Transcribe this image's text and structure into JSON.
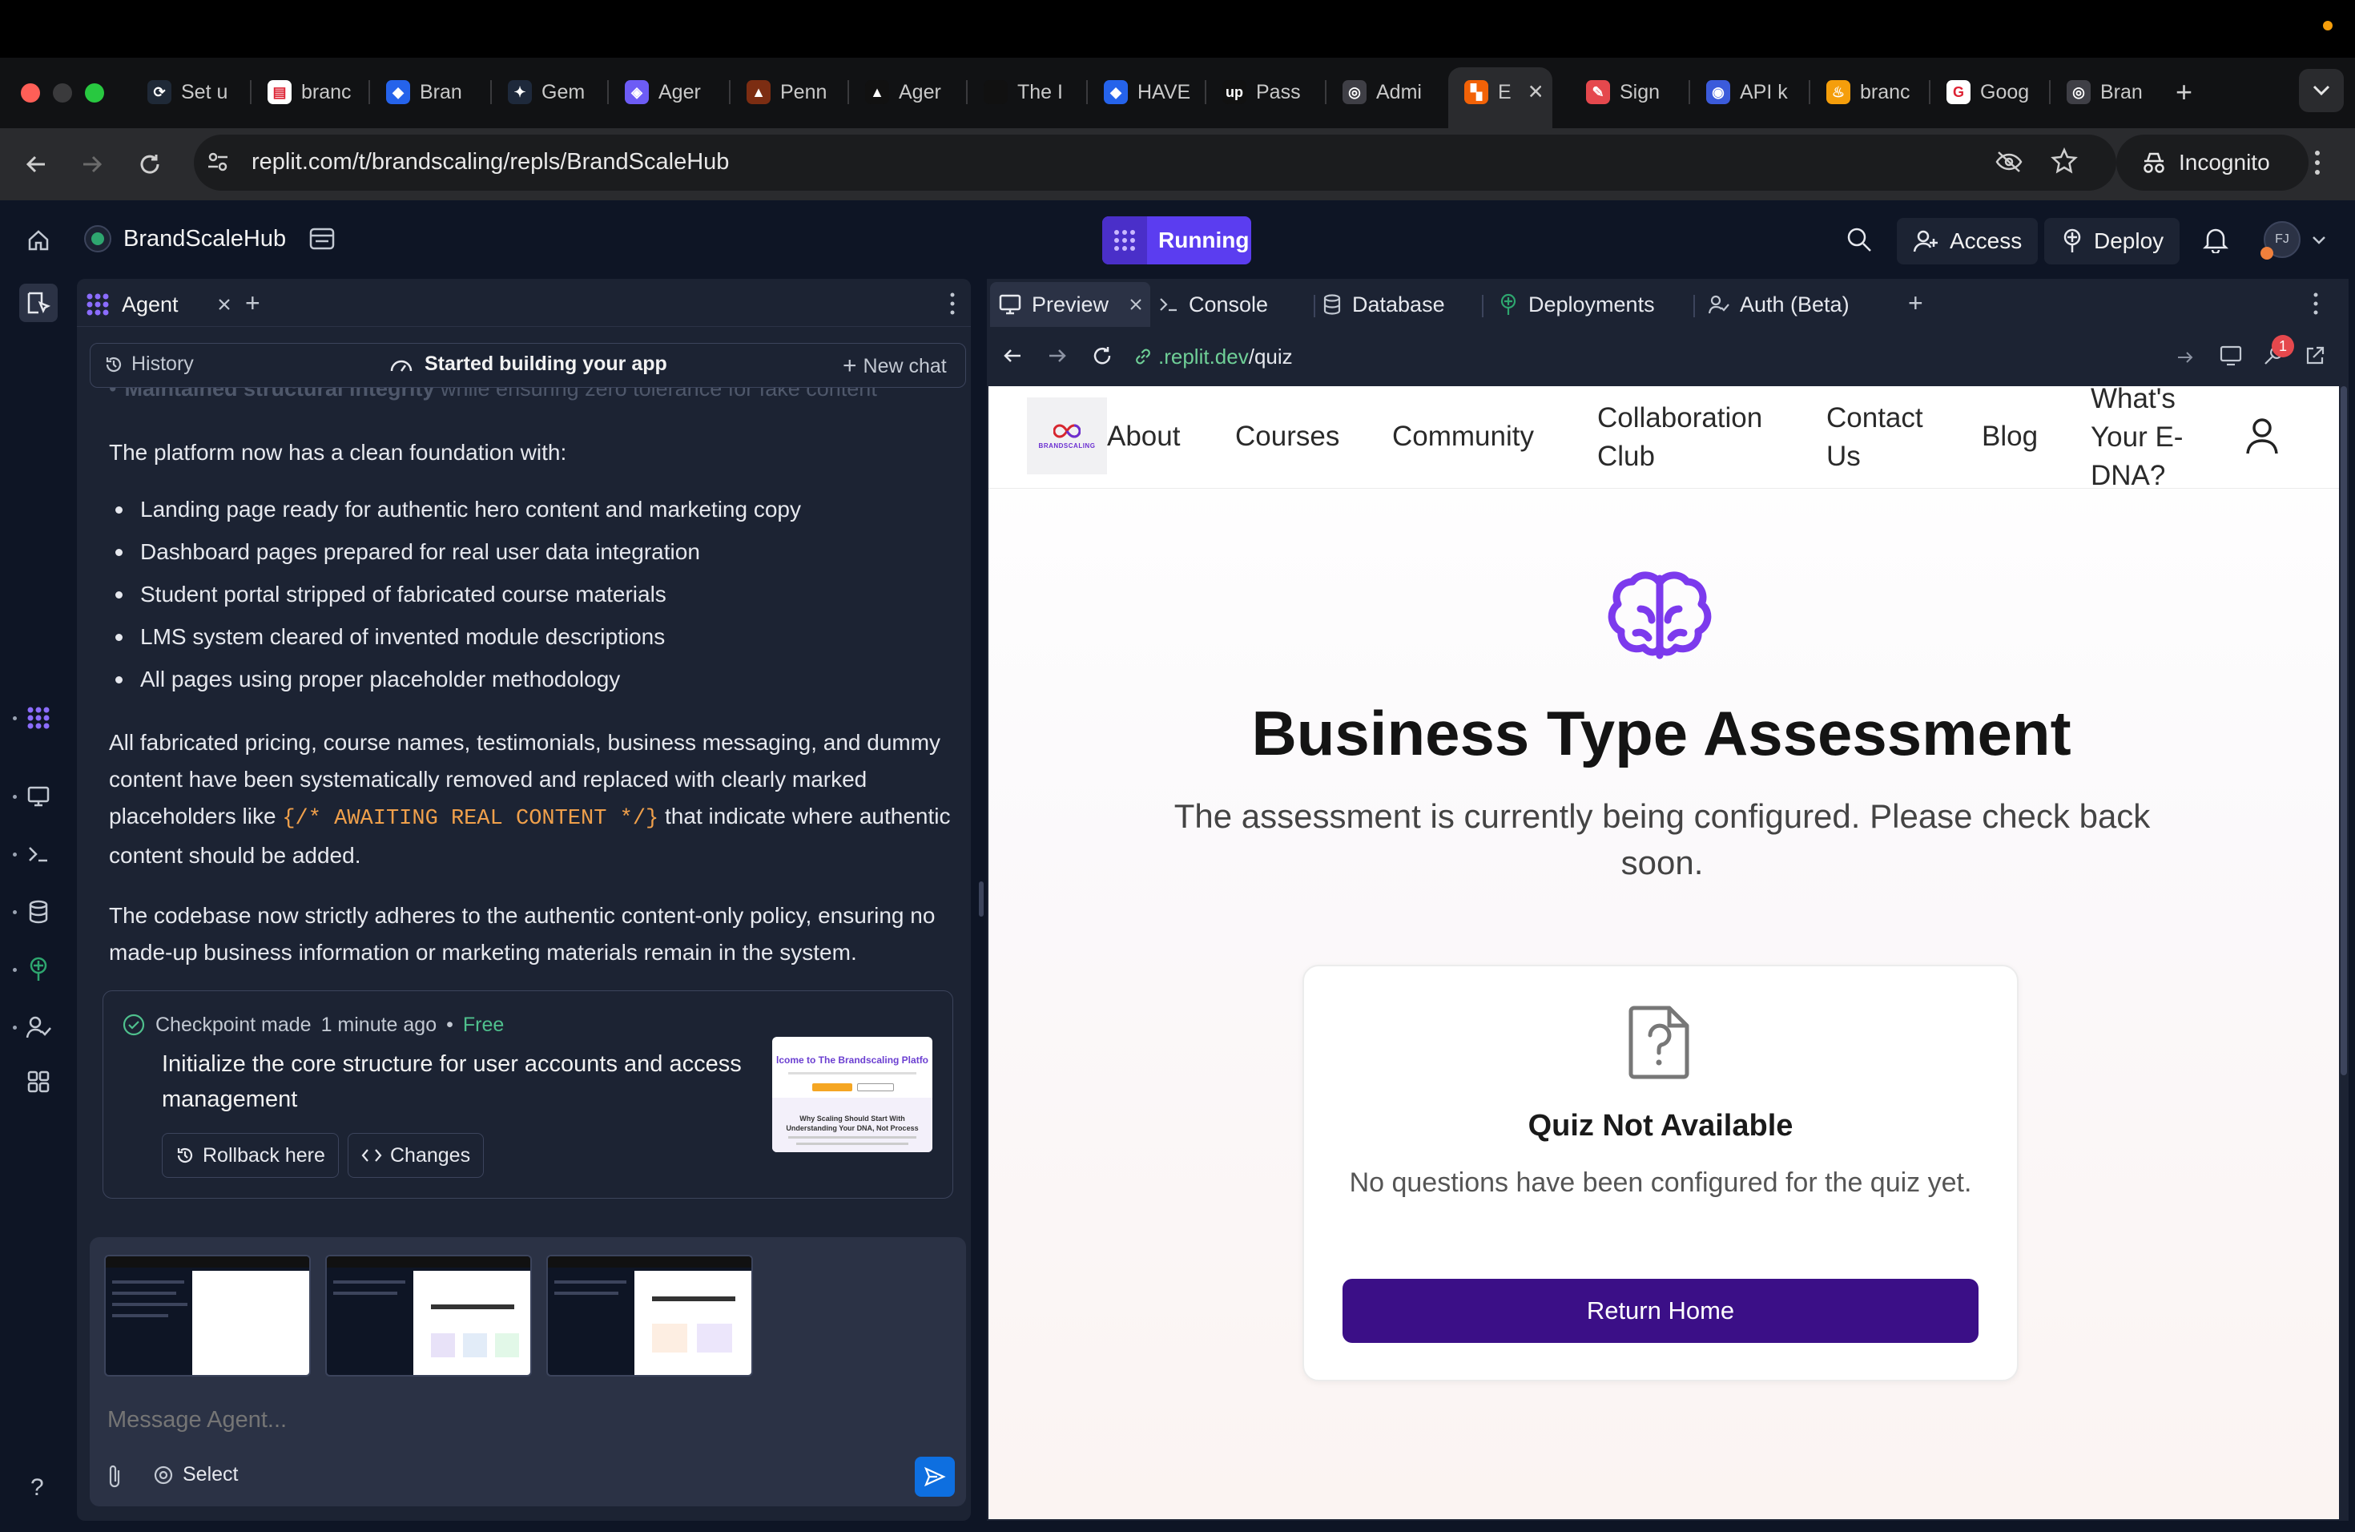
{
  "browser": {
    "tabs": [
      {
        "label": "Set u",
        "icon": "sync-icon"
      },
      {
        "label": "branc",
        "icon": "doc-icon"
      },
      {
        "label": "Bran",
        "icon": "dropbox-icon"
      },
      {
        "label": "Gem",
        "icon": "gemini-icon"
      },
      {
        "label": "Ager",
        "icon": "agent-icon"
      },
      {
        "label": "Penn",
        "icon": "penn-icon"
      },
      {
        "label": "Ager",
        "icon": "triangle-icon"
      },
      {
        "label": "The I",
        "icon": "blank-icon"
      },
      {
        "label": "HAVE",
        "icon": "dropbox-icon"
      },
      {
        "label": "Pass",
        "icon": "upwork-icon"
      },
      {
        "label": "Admi",
        "icon": "globe-icon"
      },
      {
        "label": "E",
        "icon": "replit-icon"
      },
      {
        "label": "Sign",
        "icon": "sign-icon"
      },
      {
        "label": "API k",
        "icon": "api-icon"
      },
      {
        "label": "branc",
        "icon": "fire-icon"
      },
      {
        "label": "Goog",
        "icon": "google-icon"
      },
      {
        "label": "Bran",
        "icon": "globe-icon"
      }
    ],
    "url": "replit.com/t/brandscaling/repls/BrandScaleHub",
    "incognito_label": "Incognito"
  },
  "app": {
    "project_name": "BrandScaleHub",
    "status": "Running",
    "access_label": "Access",
    "deploy_label": "Deploy",
    "avatar_initials": "FJ"
  },
  "agent": {
    "tab_label": "Agent",
    "history_label": "History",
    "status_label": "Started building your app",
    "new_chat_label": "New chat",
    "faded_line_bold": "Maintained structural integrity",
    "faded_line_rest": " while ensuring zero tolerance for fake content",
    "intro": "The platform now has a clean foundation with:",
    "bullets": [
      "Landing page ready for authentic hero content and marketing copy",
      "Dashboard pages prepared for real user data integration",
      "Student portal stripped of fabricated course materials",
      "LMS system cleared of invented module descriptions",
      "All pages using proper placeholder methodology"
    ],
    "para2_a": "All fabricated pricing, course names, testimonials, business messaging, and dummy content have been systematically removed and replaced with clearly marked placeholders like ",
    "para2_code": "{/* AWAITING REAL CONTENT */}",
    "para2_b": " that indicate where authentic content should be added.",
    "para3": "The codebase now strictly adheres to the authentic content-only policy, ensuring no made-up business information or marketing materials remain in the system.",
    "checkpoint": {
      "meta": "Checkpoint made",
      "time": "1 minute ago",
      "sep": "•",
      "tier": "Free",
      "title": "Initialize the core structure for user accounts and access management",
      "rollback_label": "Rollback here",
      "changes_label": "Changes",
      "thumb_heading": "lcome to The Brandscaling Platfo",
      "thumb_sub": "Why Scaling Should Start With Understanding Your DNA, Not Process"
    },
    "composer_placeholder": "Message Agent...",
    "select_label": "Select"
  },
  "workspace": {
    "tabs": [
      "Preview",
      "Console",
      "Database",
      "Deployments",
      "Auth (Beta)"
    ],
    "preview_url_domain": ".replit.dev",
    "preview_url_path": "/quiz",
    "notification_count": "1"
  },
  "site": {
    "logo_text": "BRANDSCALING",
    "nav": [
      "About",
      "Courses",
      "Community",
      "Collaboration Club",
      "Contact Us",
      "Blog",
      "What's Your E-DNA?"
    ],
    "title": "Business Type Assessment",
    "subtitle": "The assessment is currently being configured. Please check back soon.",
    "card_title": "Quiz Not Available",
    "card_text": "No questions have been configured for the quiz yet.",
    "button_label": "Return Home",
    "accent_color": "#3b0f87",
    "icon_color": "#7c3aed"
  }
}
